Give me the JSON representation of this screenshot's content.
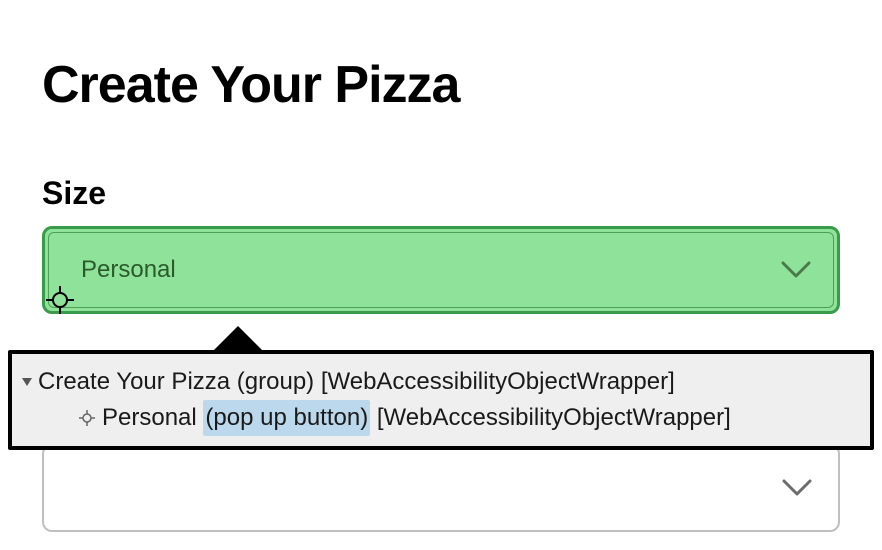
{
  "page": {
    "title": "Create Your Pizza"
  },
  "size_field": {
    "label": "Size",
    "selected": "Personal"
  },
  "second_select": {
    "selected": ""
  },
  "tooltip": {
    "row1": {
      "name": "Create Your Pizza",
      "role": "(group)",
      "class": "[WebAccessibilityObjectWrapper]"
    },
    "row2": {
      "name": "Personal",
      "role": "(pop up button)",
      "class": "[WebAccessibilityObjectWrapper]"
    }
  }
}
